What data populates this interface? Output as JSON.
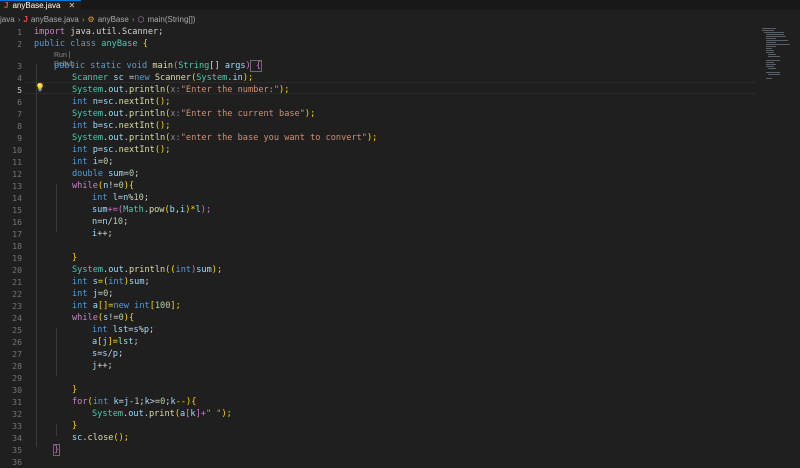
{
  "tab": {
    "title": "anyBase.java",
    "close": "✕",
    "lang_icon": "J"
  },
  "breadcrumb": {
    "root": "java",
    "file": "anyBase.java",
    "class_name": "anyBase",
    "method_name": "main(String[])"
  },
  "editor": {
    "active_line": "5",
    "codelens": "Run | Debug",
    "line_numbers": [
      "1",
      "2",
      "3",
      "4",
      "5",
      "6",
      "7",
      "8",
      "9",
      "10",
      "11",
      "12",
      "13",
      "14",
      "15",
      "16",
      "17",
      "18",
      "19",
      "20",
      "21",
      "22",
      "23",
      "24",
      "25",
      "26",
      "27",
      "28",
      "29",
      "30",
      "31",
      "32",
      "33",
      "34",
      "35",
      "36"
    ]
  },
  "code": {
    "l1": [
      "import",
      " java.util.Scanner;"
    ],
    "l2": [
      "public",
      " ",
      "class",
      " ",
      "anyBase",
      " {"
    ],
    "l3": [
      "public",
      " ",
      "static",
      " ",
      "void",
      " ",
      "main",
      "(",
      "String",
      "[]",
      " ",
      "args",
      ")",
      " {"
    ],
    "l4": [
      "Scanner",
      " ",
      "sc",
      " =",
      "new",
      " ",
      "Scanner",
      "(",
      "System",
      ".",
      "in",
      ");"
    ],
    "l5": [
      "System",
      ".",
      "out",
      ".",
      "println",
      "(",
      "x:",
      "\"Enter the number:\"",
      ");"
    ],
    "l6": [
      "int",
      " ",
      "n",
      "=",
      "sc",
      ".",
      "nextInt",
      "();"
    ],
    "l7": [
      "System",
      ".",
      "out",
      ".",
      "println",
      "(",
      "x:",
      "\"Enter the current base\"",
      ");"
    ],
    "l8": [
      "int",
      " ",
      "b",
      "=",
      "sc",
      ".",
      "nextInt",
      "();"
    ],
    "l9": [
      "System",
      ".",
      "out",
      ".",
      "println",
      "(",
      "x:",
      "\"enter the base you want to convert\"",
      ");"
    ],
    "l10": [
      "int",
      " ",
      "p",
      "=",
      "sc",
      ".",
      "nextInt",
      "();"
    ],
    "l11": [
      "int",
      " ",
      "i",
      "=",
      "0",
      ";"
    ],
    "l12": [
      "double",
      " ",
      "sum",
      "=",
      "0",
      ";"
    ],
    "l13": [
      "while",
      "(",
      "n",
      "!=",
      "0",
      "){"
    ],
    "l14": [
      "int",
      " ",
      "l",
      "=",
      "n",
      "%",
      "10",
      ";"
    ],
    "l15": [
      "sum",
      "+=(",
      "Math",
      ".",
      "pow",
      "(",
      "b",
      ",",
      "i",
      ")*",
      "l",
      ");"
    ],
    "l16": [
      "n",
      "=",
      "n",
      "/",
      "10",
      ";"
    ],
    "l17": [
      "i",
      "++;"
    ],
    "l19": [
      "}"
    ],
    "l20": [
      "System",
      ".",
      "out",
      ".",
      "println",
      "((",
      "int",
      ")",
      "sum",
      ");"
    ],
    "l21": [
      "int",
      " ",
      "s",
      "=(",
      "int",
      ")",
      "sum",
      ";"
    ],
    "l22": [
      "int",
      " ",
      "j",
      "=",
      "0",
      ";"
    ],
    "l23": [
      "int",
      " ",
      "a",
      "[]=",
      "new",
      " ",
      "int",
      "[",
      "100",
      "];"
    ],
    "l24": [
      "while",
      "(",
      "s",
      "!=",
      "0",
      "){"
    ],
    "l25": [
      "int",
      " ",
      "lst",
      "=",
      "s",
      "%",
      "p",
      ";"
    ],
    "l26": [
      "a",
      "[",
      "j",
      "]=",
      "lst",
      ";"
    ],
    "l27": [
      "s",
      "=",
      "s",
      "/",
      "p",
      ";"
    ],
    "l28": [
      "j",
      "++;"
    ],
    "l30": [
      "}"
    ],
    "l31": [
      "for",
      "(",
      "int",
      " ",
      "k",
      "=",
      "j",
      "-",
      "1",
      ";",
      "k",
      ">=",
      "0",
      ";",
      "k",
      "--){"
    ],
    "l32": [
      "System",
      ".",
      "out",
      ".",
      "print",
      "(",
      "a",
      "[",
      "k",
      "]+",
      "\" \"",
      ");"
    ],
    "l33": [
      "}"
    ],
    "l34": [
      "sc",
      ".",
      "close",
      "();"
    ],
    "l35": [
      "}"
    ]
  },
  "colors": {
    "keyword": "#569cd6",
    "control": "#c586c0",
    "type": "#4ec9b0",
    "function": "#dcdcaa",
    "variable": "#9cdcfe",
    "string": "#ce9178",
    "number": "#b5cea8",
    "background": "#1f1f1f"
  },
  "icons": {
    "file": "java-file-icon",
    "class": "class-icon",
    "method": "method-icon",
    "lightbulb": "lightbulb-icon"
  }
}
